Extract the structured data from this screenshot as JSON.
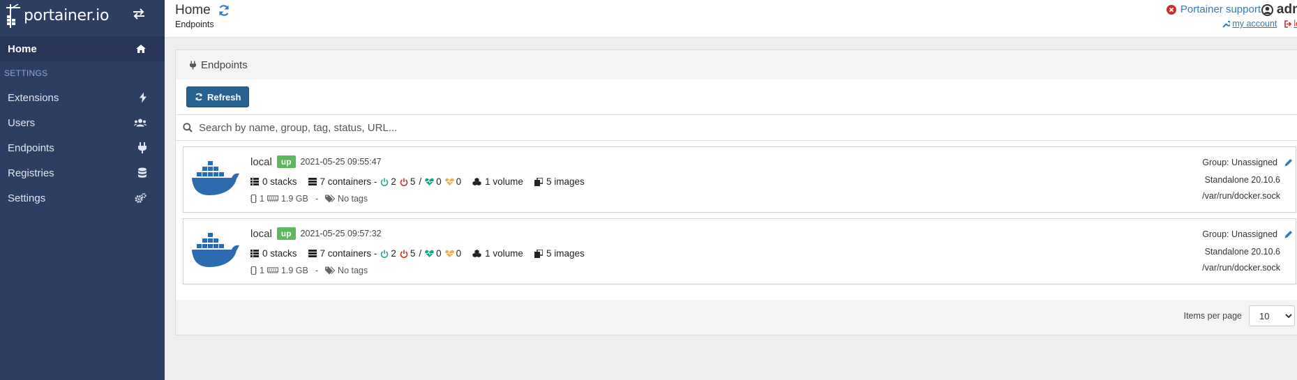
{
  "brand": {
    "name": "portainer.io"
  },
  "sidebar": {
    "home_label": "Home",
    "section_heading": "SETTINGS",
    "items": [
      {
        "label": "Extensions",
        "icon": "bolt-icon"
      },
      {
        "label": "Users",
        "icon": "users-icon"
      },
      {
        "label": "Endpoints",
        "icon": "plug-icon"
      },
      {
        "label": "Registries",
        "icon": "database-icon"
      },
      {
        "label": "Settings",
        "icon": "cogs-icon"
      }
    ]
  },
  "header": {
    "title": "Home",
    "breadcrumb": "Endpoints",
    "support_label": "Portainer support",
    "username": "adm",
    "my_account_label": "my account",
    "logout_label": "log"
  },
  "widget": {
    "title": "Endpoints",
    "refresh_label": "Refresh",
    "search_placeholder": "Search by name, group, tag, status, URL...",
    "items_per_page_label": "Items per page",
    "items_per_page_value": "10"
  },
  "endpoints": [
    {
      "name": "local",
      "status": "up",
      "timestamp": "2021-05-25 09:55:47",
      "stacks": "0 stacks",
      "containers": "7 containers -",
      "running": "2",
      "stopped": "5",
      "separator": "/",
      "healthy": "0",
      "unhealthy": "0",
      "volumes": "1 volume",
      "images": "5 images",
      "cpu": "1",
      "memory": "1.9 GB",
      "dash": "-",
      "tags": "No tags",
      "group": "Group: Unassigned",
      "type": "Standalone 20.10.6",
      "url": "/var/run/docker.sock"
    },
    {
      "name": "local",
      "status": "up",
      "timestamp": "2021-05-25 09:57:32",
      "stacks": "0 stacks",
      "containers": "7 containers -",
      "running": "2",
      "stopped": "5",
      "separator": "/",
      "healthy": "0",
      "unhealthy": "0",
      "volumes": "1 volume",
      "images": "5 images",
      "cpu": "1",
      "memory": "1.9 GB",
      "dash": "-",
      "tags": "No tags",
      "group": "Group: Unassigned",
      "type": "Standalone 20.10.6",
      "url": "/var/run/docker.sock"
    }
  ],
  "colors": {
    "sidebar_bg": "#2d3e63",
    "primary_button": "#286090",
    "badge_up": "#5cb85c",
    "running": "#2aa198",
    "stopped": "#c9302c",
    "healthy": "#17a589",
    "unhealthy": "#f0ad4e",
    "link": "#337ab7"
  }
}
